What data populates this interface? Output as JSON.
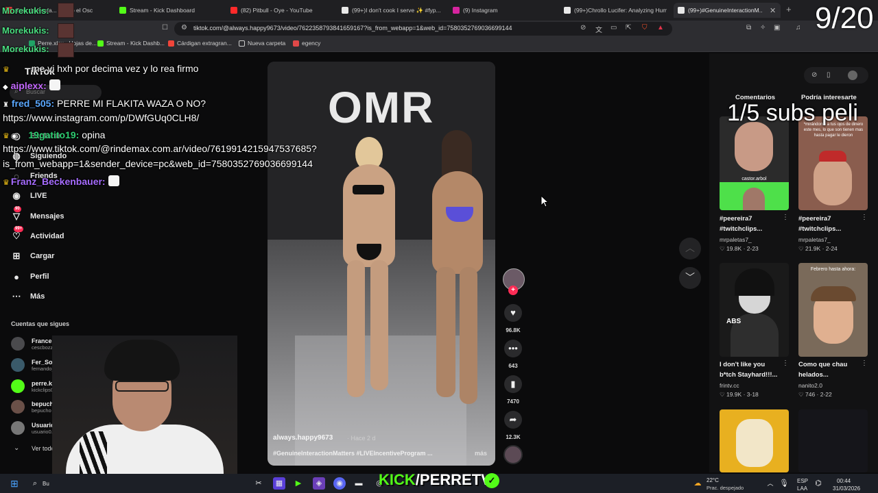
{
  "browser": {
    "tabs": [
      {
        "label": "Tras de Pesfa... perdió el Osc",
        "color": "#e23b3b"
      },
      {
        "label": "Stream - Kick Dashboard",
        "color": "#53fc18"
      },
      {
        "label": "(82) Pitbull - Oye - YouTube",
        "color": "#ff2a2a"
      },
      {
        "label": "(99+)I don't cook I serve ✨ #fyp...",
        "color": "#e8e8e8"
      },
      {
        "label": "(9) Instagram",
        "color": "#d6249f"
      },
      {
        "label": "(99+)Chrollo Lucifer: Analyzing Hum",
        "color": "#e8e8e8"
      },
      {
        "label": "(99+)#GenuineInteractionM...",
        "color": "#e8e8e8"
      }
    ],
    "tab_close": "✕",
    "new_tab": "+",
    "url": "tiktok.com/@always.happy9673/video/7622358793841659167?is_from_webapp=1&web_id=7580352769036699144",
    "bookmarks": [
      {
        "label": "Perre.xlsx - Hojas de...",
        "color": "#21a366"
      },
      {
        "label": "Stream - Kick Dashb...",
        "color": "#53fc18"
      },
      {
        "label": "Cárdigan extragran...",
        "color": "#f0453a"
      },
      {
        "label": "Nueva carpeta",
        "color": "#cfcfcf"
      },
      {
        "label": "egency",
        "color": "#e04848"
      }
    ]
  },
  "tiktok": {
    "logo": "TikTok",
    "search_placeholder": "Buscar",
    "nav": [
      {
        "label": "Explorar",
        "icon": "compass-icon",
        "glyph": "◎"
      },
      {
        "label": "Siguiendo",
        "icon": "following-icon",
        "glyph": "◍"
      },
      {
        "label": "Friends",
        "icon": "friends-icon",
        "glyph": "◌"
      },
      {
        "label": "LIVE",
        "icon": "live-icon",
        "glyph": "◉"
      },
      {
        "label": "Mensajes",
        "icon": "messages-icon",
        "glyph": "▽",
        "badge": "90"
      },
      {
        "label": "Actividad",
        "icon": "activity-icon",
        "glyph": "♡",
        "badge": "99+"
      },
      {
        "label": "Cargar",
        "icon": "upload-icon",
        "glyph": "⊞"
      },
      {
        "label": "Perfil",
        "icon": "profile-icon",
        "glyph": "●"
      },
      {
        "label": "Más",
        "icon": "more-icon",
        "glyph": "⋯"
      }
    ],
    "following_title": "Cuentas que sigues",
    "following": [
      {
        "name": "Francesco Bozzo",
        "handle": "cescbozzo"
      },
      {
        "name": "Fer_Sosa10(GCyosoy)",
        "handle": "fernando_sosa_10"
      },
      {
        "name": "perre.klips0",
        "handle": "kickclips000"
      },
      {
        "name": "bepucho",
        "handle": "bepucho"
      },
      {
        "name": "Usuario 0",
        "handle": "usuario0.us"
      }
    ],
    "see_all": "Ver todo"
  },
  "chat": {
    "overlay_names": [
      "Morekukis:",
      "Morekukis:",
      "Morekukis:"
    ],
    "lines": [
      {
        "user": "",
        "text": "me vi hxh por decima vez y lo rea firmo",
        "color": "#ffffff"
      },
      {
        "user": "aiplexx:",
        "text": "",
        "color": "#c468ff"
      },
      {
        "user": "fred_505:",
        "text": "PERRE MI FLAKITA WAZA O NO?",
        "color": "#5aa8ff"
      },
      {
        "user": "",
        "text": "https://www.instagram.com/p/DWfGUq0CLH8/",
        "color": "#ffffff"
      },
      {
        "user": "19gatito19:",
        "text": "opina",
        "color": "#2ecc71"
      },
      {
        "user": "",
        "text": "https://www.tiktok.com/@rindemax.com.ar/video/7619914215947537685?",
        "color": "#ffffff"
      },
      {
        "user": "",
        "text": "is_from_webapp=1&sender_device=pc&web_id=7580352769036699144",
        "color": "#ffffff"
      },
      {
        "user": "Franz_Beckenbauer:",
        "text": "",
        "color": "#a66cff"
      }
    ]
  },
  "video": {
    "brand": "OMR",
    "author": "always.happy9673",
    "time": "· Hace 2 d",
    "caption": "#GenuineInteractionMatters #LIVEIncentiveProgram ...",
    "more": "más",
    "likes": "96.8K",
    "comments": "643",
    "saves": "7470",
    "shares": "12.3K",
    "plus": "+"
  },
  "right_panel": {
    "tabs": [
      "Comentarios",
      "Podría interesarte"
    ],
    "cards": [
      {
        "title": "#peereira7 #twitchclips...",
        "author": "mrpaletas7_",
        "likes": "19.8K",
        "date": "2-23",
        "colors": [
          "#2b2b2b",
          "#c89a86",
          "#4ee04a"
        ],
        "overlay_text": "castor.arbol"
      },
      {
        "title": "#peereira7 #twitchclips...",
        "author": "mrpaletas7_",
        "likes": "21.9K",
        "date": "2-24",
        "colors": [
          "#8a5d4e",
          "#d0a288",
          "#3a3a3a"
        ],
        "overlay_text": "*mirándome a tus ojos de dinero este mes, lo que son tienen mas hasta pagar le dieron"
      },
      {
        "title": "I don't like you b*tch Stayhard!!!...",
        "author": "frintv.cc",
        "likes": "19.9K",
        "date": "3-18",
        "colors": [
          "#1a1a1a",
          "#d6d6d6",
          "#111111"
        ],
        "overlay_text": "ABS"
      },
      {
        "title": "Como que chau helados...",
        "author": "nanito2.0",
        "likes": "746",
        "date": "2-22",
        "colors": [
          "#7a6a5a",
          "#e0b090",
          "#5a4a3a"
        ],
        "overlay_text": "Febrero hasta ahora:"
      }
    ]
  },
  "overlays": {
    "counter": "9/20",
    "subs": "1/5 subs peli",
    "kick_banner_k": "KICK",
    "kick_banner_rest": "/PERRETV",
    "check": "✓"
  },
  "taskbar": {
    "search": "Bu",
    "weather_temp": "22°C",
    "weather_desc": "Prac. despejado",
    "lang_top": "ESP",
    "lang_bottom": "LAA",
    "time": "00:44",
    "date": "31/03/2026"
  }
}
